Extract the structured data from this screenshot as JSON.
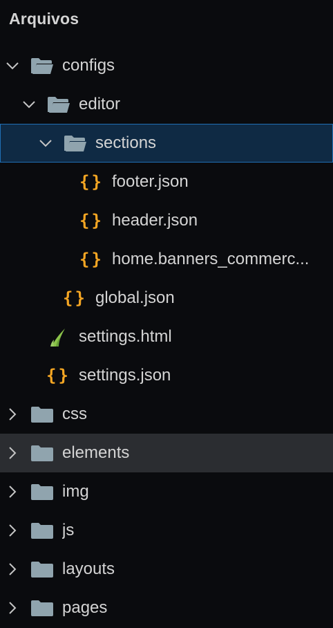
{
  "panel": {
    "title": "Arquivos"
  },
  "tree": {
    "configs": "configs",
    "editor": "editor",
    "sections": "sections",
    "footer_json": "footer.json",
    "header_json": "header.json",
    "home_banners": "home.banners_commerc...",
    "global_json": "global.json",
    "settings_html": "settings.html",
    "settings_json": "settings.json",
    "css": "css",
    "elements": "elements",
    "img": "img",
    "js": "js",
    "layouts": "layouts",
    "pages": "pages"
  },
  "icons": {
    "folder_open": "folder-open-icon",
    "folder_closed": "folder-icon",
    "json": "json-file-icon",
    "twig": "twig-file-icon",
    "expanded": "chevron-down-icon",
    "collapsed": "chevron-right-icon"
  },
  "colors": {
    "background": "#0a0b0e",
    "selected_background": "#0f2a44",
    "selected_border": "#1f6fb5",
    "hover_background": "#2b2d31",
    "json_icon": "#f5a623",
    "folder_icon": "#90a4ae"
  }
}
